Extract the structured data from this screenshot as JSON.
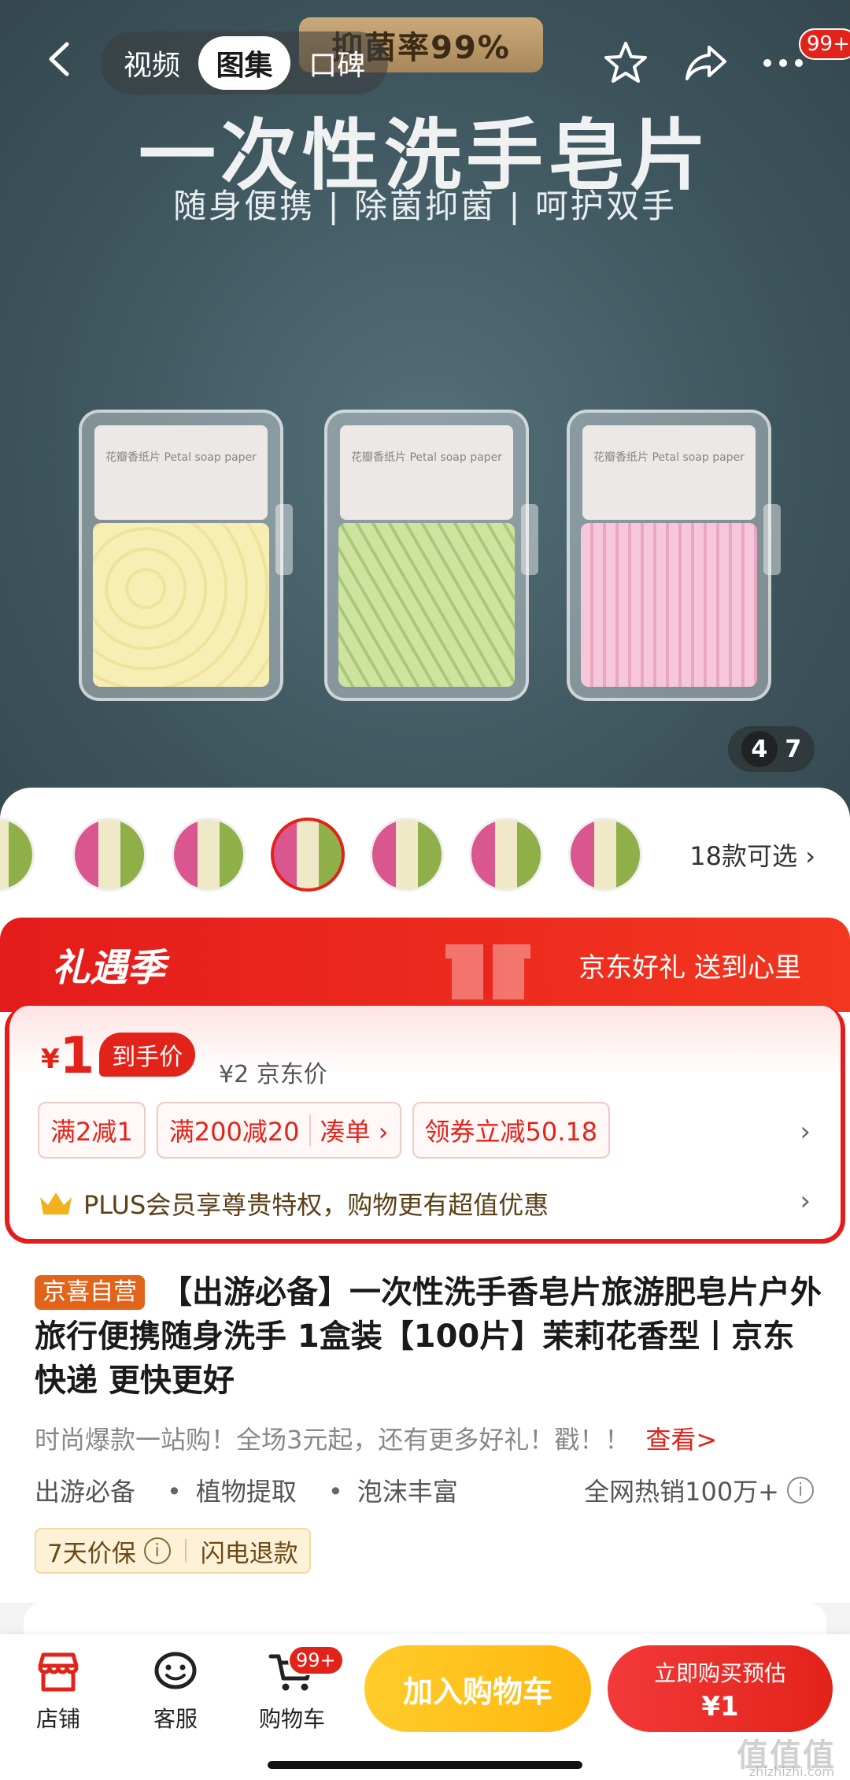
{
  "hero": {
    "badge": "抑菌率99%",
    "title": "一次性洗手皂片",
    "subtitle": "随身便携 | 除菌抑菌 | 呵护双手",
    "box_labels": [
      "花瓣香纸片\nPetal soap paper",
      "花瓣香纸片\nPetal soap paper",
      "花瓣香纸片\nPetal soap paper"
    ],
    "counter_current": "4",
    "counter_total": "7"
  },
  "topbar": {
    "tabs": [
      {
        "label": "视频"
      },
      {
        "label": "图集"
      },
      {
        "label": "口碑"
      }
    ],
    "more_badge": "99+"
  },
  "variants": {
    "more_label": "18款可选 ›"
  },
  "promo": {
    "logo": "礼遇季",
    "slogan": "京东好礼 送到心里",
    "price_symbol": "¥",
    "price_value": "1",
    "price_tag": "到手价",
    "jd_price": "¥2 京东价",
    "chips": [
      "满2减1",
      "满200减20",
      "凑单 ›",
      "领券立减50.18"
    ],
    "plus_text": "PLUS会员享尊贵特权，购物更有超值优惠",
    "arrow": "›"
  },
  "product": {
    "self_tag": "京喜自营",
    "title": "【出游必备】一次性洗手香皂片旅游肥皂片户外旅行便携随身洗手 1盒装【100片】茉莉花香型丨京东快递 更快更好",
    "promo_text": "时尚爆款一站购！全场3元起，还有更多好礼！戳！！",
    "promo_link": "查看>",
    "tags": [
      "出游必备",
      "植物提取",
      "泡沫丰富"
    ],
    "hot_sales": "全网热销100万+",
    "services": [
      "7天价保",
      "闪电退款"
    ],
    "info_glyph": "i"
  },
  "bottom_bar": {
    "shop": "店铺",
    "service": "客服",
    "cart": "购物车",
    "cart_badge": "99+",
    "add_to_cart": "加入购物车",
    "buy_now": "立即购买预估",
    "buy_price": "¥1"
  },
  "watermark": {
    "text": "值值值",
    "site": "zhizhizhi.com"
  },
  "colors": {
    "jd_red": "#e2231a",
    "cart_yellow": "#ffbf1a",
    "self_tag_orange": "#e2631a"
  }
}
